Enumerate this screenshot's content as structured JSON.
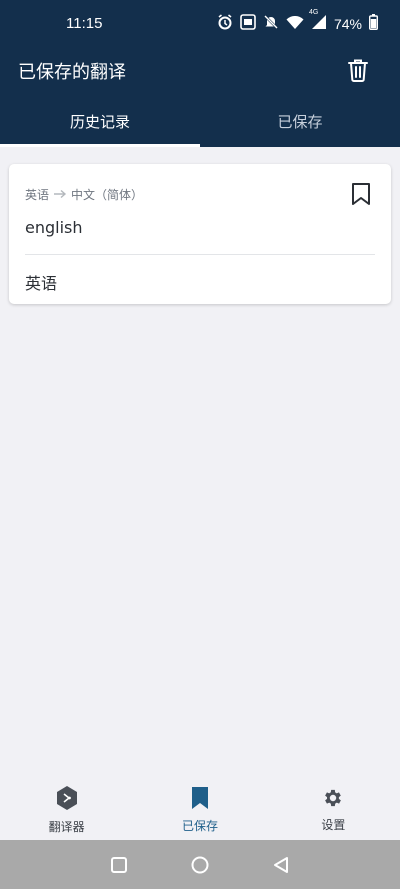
{
  "status": {
    "time": "11:15",
    "battery": "74%",
    "network": "4G",
    "icons": [
      "alarm-icon",
      "volte-icon",
      "mute-icon",
      "wifi-icon",
      "signal-icon",
      "battery-icon"
    ]
  },
  "appbar": {
    "title": "已保存的翻译",
    "trash_icon": "trash-icon"
  },
  "tabs": [
    {
      "label": "历史记录",
      "active": true
    },
    {
      "label": "已保存",
      "active": false
    }
  ],
  "card": {
    "source_lang": "英语",
    "target_lang": "中文（简体）",
    "source_text": "english",
    "target_text": "英语"
  },
  "bottom_nav": [
    {
      "label": "翻译器",
      "icon": "translator-icon",
      "active": false
    },
    {
      "label": "已保存",
      "icon": "bookmark-icon",
      "active": true
    },
    {
      "label": "设置",
      "icon": "gear-icon",
      "active": false
    }
  ],
  "colors": {
    "header": "#132f4c",
    "accent": "#1f5f8a",
    "background": "#f1f1f5"
  }
}
